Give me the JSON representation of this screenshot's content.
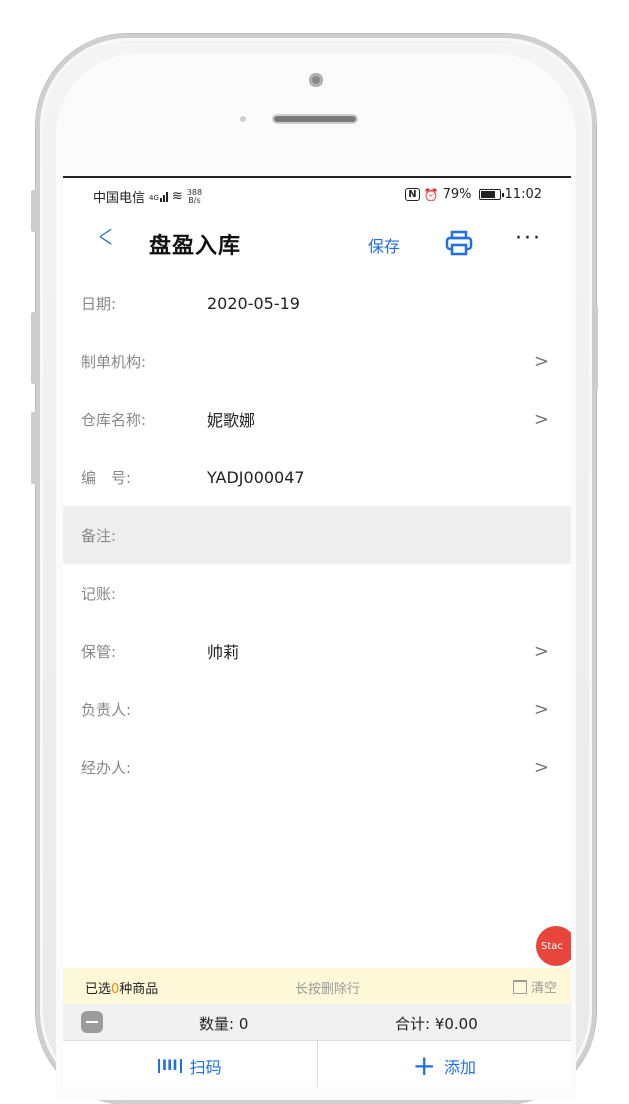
{
  "status": {
    "carrier": "中国电信",
    "net_type": "4G",
    "net_speed_value": "388",
    "net_speed_unit": "B/s",
    "nfc": "N",
    "alarm": "⏰",
    "battery_pct": "79%",
    "battery_level": 0.79,
    "time": "11:02"
  },
  "nav": {
    "back": "<",
    "title": "盘盈入库",
    "save": "保存",
    "more": "···"
  },
  "form": {
    "rows": [
      {
        "label": "日期:",
        "value": "2020-05-19",
        "chevron": ""
      },
      {
        "label": "制单机构:",
        "value": "",
        "chevron": ">"
      },
      {
        "label": "仓库名称:",
        "value": "妮歌娜",
        "chevron": ">"
      },
      {
        "label": "编　号:",
        "value": "YADJ000047",
        "chevron": ""
      },
      {
        "label": "备注:",
        "value": "",
        "chevron": ""
      },
      {
        "label": "记账:",
        "value": "",
        "chevron": ""
      },
      {
        "label": "保管:",
        "value": "帅莉",
        "chevron": ">"
      },
      {
        "label": "负责人:",
        "value": "",
        "chevron": ">"
      },
      {
        "label": "经办人:",
        "value": "",
        "chevron": ">"
      }
    ]
  },
  "floating": {
    "stack": "Stac"
  },
  "selection": {
    "prefix": "已选",
    "count": "0",
    "suffix": "种商品",
    "hint": "长按删除行",
    "clear": "清空"
  },
  "summary": {
    "qty_label": "数量: 0",
    "total_label": "合计: ¥0.00"
  },
  "actions": {
    "scan": "扫码",
    "scan_icon": "III",
    "add": "添加",
    "add_icon": "+"
  },
  "colors": {
    "accent": "#1f6fe5",
    "badge": "#e8453c",
    "count": "#f08a00"
  }
}
